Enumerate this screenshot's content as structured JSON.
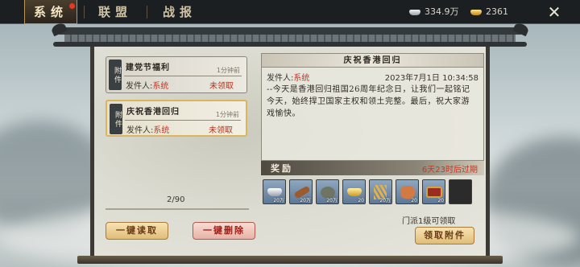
{
  "tabs": [
    {
      "label": "系统",
      "active": true,
      "has_notification": true
    },
    {
      "label": "联盟",
      "active": false
    },
    {
      "label": "战报",
      "active": false
    }
  ],
  "resources": {
    "silver": {
      "icon": "silver-ingot-icon",
      "value": "334.9万"
    },
    "gold": {
      "icon": "gold-ingot-icon",
      "value": "2361"
    }
  },
  "close_icon": "close-icon",
  "mail_list": {
    "items": [
      {
        "tag": "附件",
        "title": "建党节福利",
        "time": "1分钟前",
        "sender_label": "发件人:",
        "sender": "系统",
        "status": "未领取",
        "selected": false
      },
      {
        "tag": "附件",
        "title": "庆祝香港回归",
        "time": "1分钟前",
        "sender_label": "发件人:",
        "sender": "系统",
        "status": "未领取",
        "selected": true
      }
    ],
    "count": "2/90"
  },
  "mail_detail": {
    "title": "庆祝香港回归",
    "sender_label": "发件人:",
    "sender": "系统",
    "date": "2023年7月1日 10:34:58",
    "body": "--今天是香港回归祖国26周年纪念日，让我们一起铭记今天，始终捍卫国家主权和领土完整。最后，祝大家游戏愉快。"
  },
  "rewards": {
    "label": "奖励",
    "expire": "6天23时后过期",
    "items": [
      {
        "icon": "silver-ingot-icon",
        "count": "20万"
      },
      {
        "icon": "wood-log-icon",
        "count": "20万"
      },
      {
        "icon": "stone-icon",
        "count": "20万"
      },
      {
        "icon": "gold-ingot-icon",
        "count": "20"
      },
      {
        "icon": "wheat-icon",
        "count": "20万"
      },
      {
        "icon": "frog-icon",
        "count": "20"
      },
      {
        "icon": "treasure-chest-icon",
        "count": "20"
      },
      {
        "icon": "empty-slot",
        "count": ""
      }
    ]
  },
  "footer": {
    "note": "门派1级可领取",
    "read_all": "一键读取",
    "delete_all": "一键删除",
    "claim": "领取附件"
  }
}
